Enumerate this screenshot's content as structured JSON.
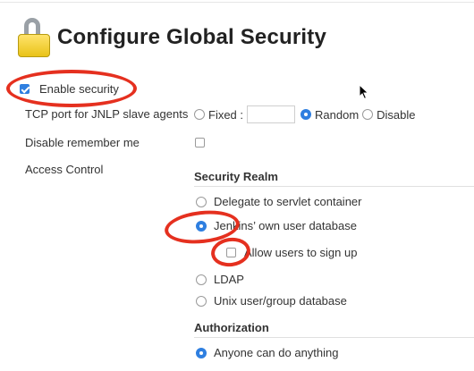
{
  "page": {
    "title": "Configure Global Security",
    "lock_icon": "lock-icon"
  },
  "enable_security": {
    "label": "Enable security",
    "checked": true
  },
  "tcp_port": {
    "label": "TCP port for JNLP slave agents",
    "options": {
      "fixed": "Fixed :",
      "random": "Random",
      "disable": "Disable"
    },
    "selected": "Random",
    "fixed_value": ""
  },
  "disable_remember_me": {
    "label": "Disable remember me",
    "checked": false
  },
  "access_control": {
    "label": "Access Control"
  },
  "security_realm": {
    "heading": "Security Realm",
    "options": {
      "servlet": "Delegate to servlet container",
      "jenkins_db": "Jenkins’ own user database",
      "allow_signup": "Allow users to sign up",
      "ldap": "LDAP",
      "unix": "Unix user/group database"
    },
    "selected": "Jenkins’ own user database",
    "allow_signup_checked": false
  },
  "authorization": {
    "heading": "Authorization",
    "options": {
      "anyone": "Anyone can do anything"
    },
    "selected": "Anyone can do anything"
  },
  "annotation_color": "#e5301f",
  "accent_color": "#2f7fe0"
}
